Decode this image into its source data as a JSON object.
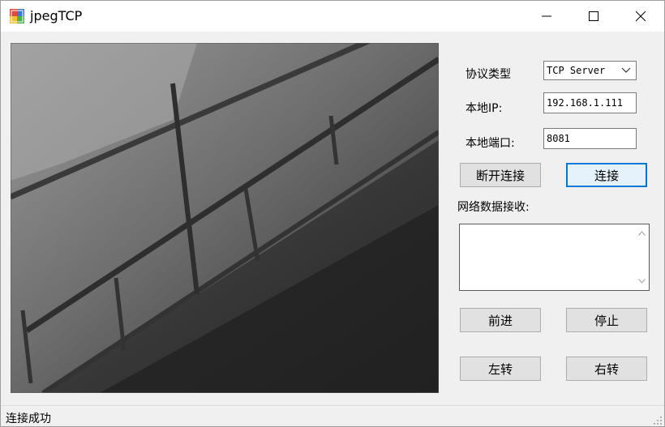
{
  "window": {
    "title": "jpegTCP",
    "controls": [
      "minimize-icon",
      "maximize-icon",
      "close-icon"
    ]
  },
  "video_panel": {
    "content": "camera image"
  },
  "settings": {
    "protocol_label": "协议类型",
    "protocol_value": "TCP Server",
    "ip_label": "本地IP:",
    "ip_value": "192.168.1.111",
    "port_label": "本地端口:",
    "port_value": "8081"
  },
  "buttons": {
    "disconnect": "断开连接",
    "connect": "连接",
    "forward": "前进",
    "stop": "停止",
    "left": "左转",
    "right": "右转"
  },
  "receive": {
    "label": "网络数据接收:",
    "content": ""
  },
  "status": {
    "text": "连接成功"
  },
  "colors": {
    "accent": "#0078d7",
    "window_bg": "#f0f0f0"
  }
}
